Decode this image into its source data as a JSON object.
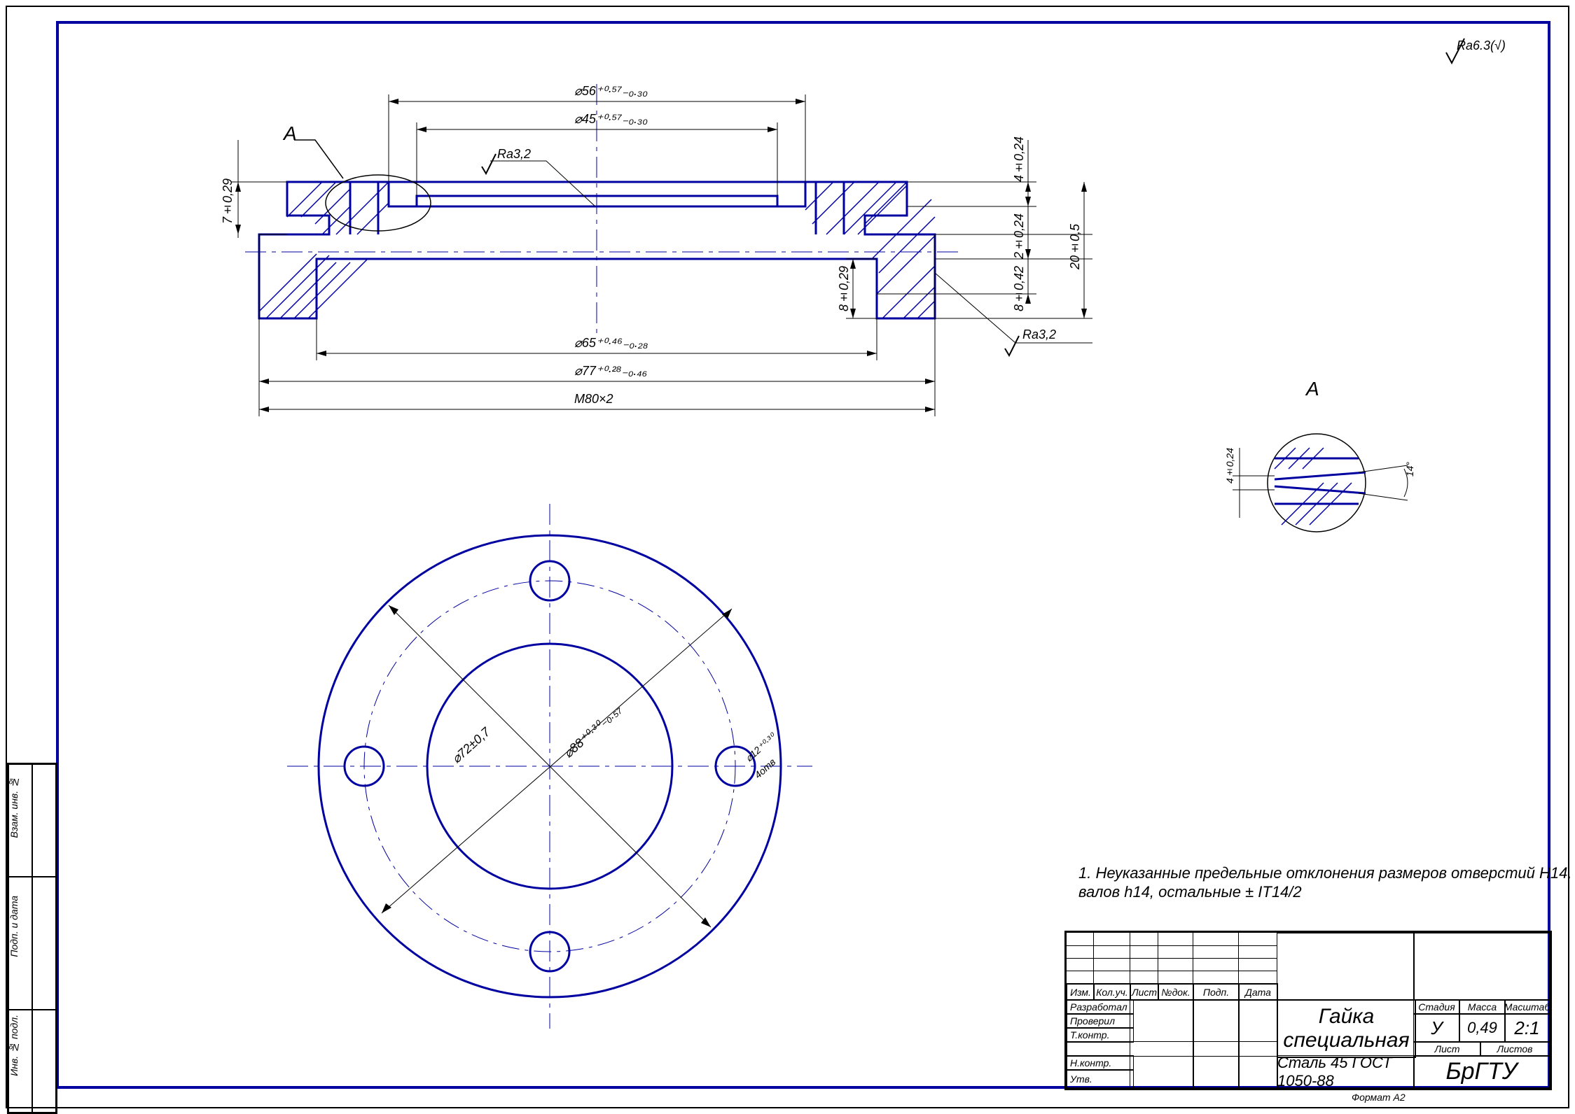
{
  "drawing": {
    "section_label": "А",
    "detail_label": "А",
    "surface_finish_general": "Ra6.3(√)",
    "surface_finish_local_1": "Ra3,2",
    "surface_finish_local_2": "Ra3,2",
    "dims_section": {
      "d56": "⌀56⁺⁰·⁵⁷₋₀.₃₀",
      "d45": "⌀45⁺⁰·⁵⁷₋₀.₃₀",
      "d65": "⌀65⁺⁰·⁴⁶₋₀.₂₈",
      "d77": "⌀77⁺⁰·²⁸₋₀.₄₆",
      "m80": "M80×2",
      "h7": "7±0,29",
      "h4": "4±0,24",
      "h2": "2±0,24",
      "h20": "20±0,5",
      "h8_1": "8±0,29",
      "h8_2": "8±0,42"
    },
    "dims_front": {
      "d72": "⌀72±0,7",
      "d88": "⌀88⁺⁰·³⁰₋₀.₅₇",
      "d12": "⌀12⁺⁰·³⁰",
      "holes": "4отв"
    },
    "dims_detail": {
      "angle": "14°",
      "h4": "4±0,24"
    }
  },
  "notes": {
    "line1": "1. Неуказанные предельные отклонения размеров отверстий H14,",
    "line2": "валов h14, остальные ± IT14/2"
  },
  "title_block": {
    "part_name_1": "Гайка",
    "part_name_2": "специальная",
    "material": "Сталь 45 ГОСТ 1050-88",
    "org": "БрГТУ",
    "headers": {
      "izm": "Изм.",
      "kol": "Кол.уч.",
      "list": "Лист",
      "ndok": "№док.",
      "podp": "Подп.",
      "data": "Дата",
      "razrab": "Разработал",
      "prover": "Проверил",
      "tkontr": "Т.контр.",
      "nkontr": "Н.контр.",
      "utv": "Утв.",
      "stadia": "Стадия",
      "massa": "Масса",
      "masshtab": "Масштаб",
      "list2": "Лист",
      "listov": "Листов",
      "format": "Формат   А2"
    },
    "values": {
      "stadia": "У",
      "massa": "0,49",
      "masshtab": "2:1"
    }
  },
  "side_block": {
    "inv_podl": "Инв. № подл.",
    "podp_data": "Подп. и дата",
    "vzam_inv": "Взам. инв. №"
  }
}
